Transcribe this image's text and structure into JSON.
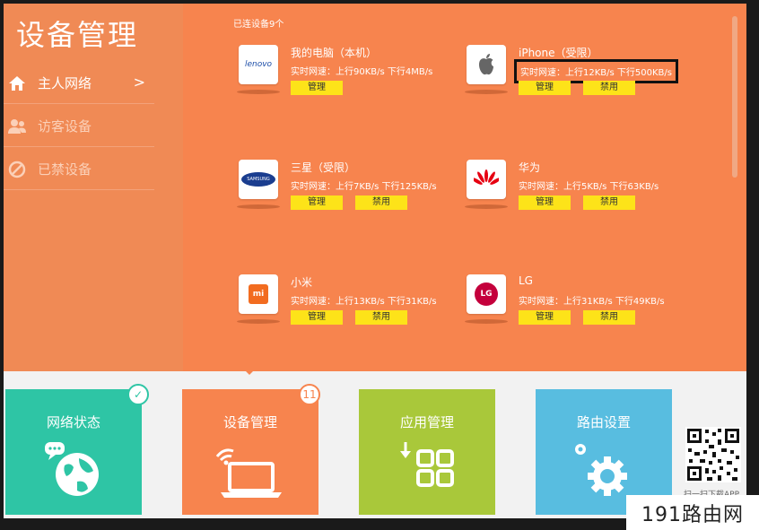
{
  "app": {
    "title": "设备管理"
  },
  "sidebar": {
    "items": [
      {
        "label": "主人网络",
        "arrow": ">",
        "icon": "home-icon"
      },
      {
        "label": "访客设备",
        "icon": "users-icon"
      },
      {
        "label": "已禁设备",
        "icon": "blocked-icon"
      }
    ]
  },
  "main": {
    "connected_label": "已连设备9个",
    "devices": [
      {
        "name": "我的电脑（本机）",
        "speed": "实时网速：上行90KB/s 下行4MB/s",
        "buttons": [
          "管理"
        ],
        "logo": "lenovo",
        "logo_text": "lenovo"
      },
      {
        "name": "iPhone（受限）",
        "speed": "实时网速：上行12KB/s 下行500KB/s",
        "buttons": [
          "管理",
          "禁用"
        ],
        "logo": "apple",
        "highlighted": true
      },
      {
        "name": "三星（受限）",
        "speed": "实时网速：上行7KB/s 下行125KB/s",
        "buttons": [
          "管理",
          "禁用"
        ],
        "logo": "samsung",
        "logo_text": "SAMSUNG"
      },
      {
        "name": "华为",
        "speed": "实时网速：上行5KB/s 下行63KB/s",
        "buttons": [
          "管理",
          "禁用"
        ],
        "logo": "huawei"
      },
      {
        "name": "小米",
        "speed": "实时网速：上行13KB/s 下行31KB/s",
        "buttons": [
          "管理",
          "禁用"
        ],
        "logo": "xiaomi",
        "logo_text": "mi"
      },
      {
        "name": "LG",
        "speed": "实时网速：上行31KB/s 下行49KB/s",
        "buttons": [
          "管理",
          "禁用"
        ],
        "logo": "lg",
        "logo_text": "LG"
      }
    ]
  },
  "tiles": [
    {
      "label": "网络状态",
      "color": "#2ec5a5",
      "icon": "globe-chat-icon",
      "badge": "✓"
    },
    {
      "label": "设备管理",
      "color": "#f7844e",
      "icon": "laptop-wifi-icon",
      "badge": "11"
    },
    {
      "label": "应用管理",
      "color": "#a9c83a",
      "icon": "app-grid-icon"
    },
    {
      "label": "路由设置",
      "color": "#58bde0",
      "icon": "gear-icon"
    }
  ],
  "qr": {
    "label": "扫一扫下载APP"
  },
  "watermark": {
    "text": "191路由网"
  }
}
